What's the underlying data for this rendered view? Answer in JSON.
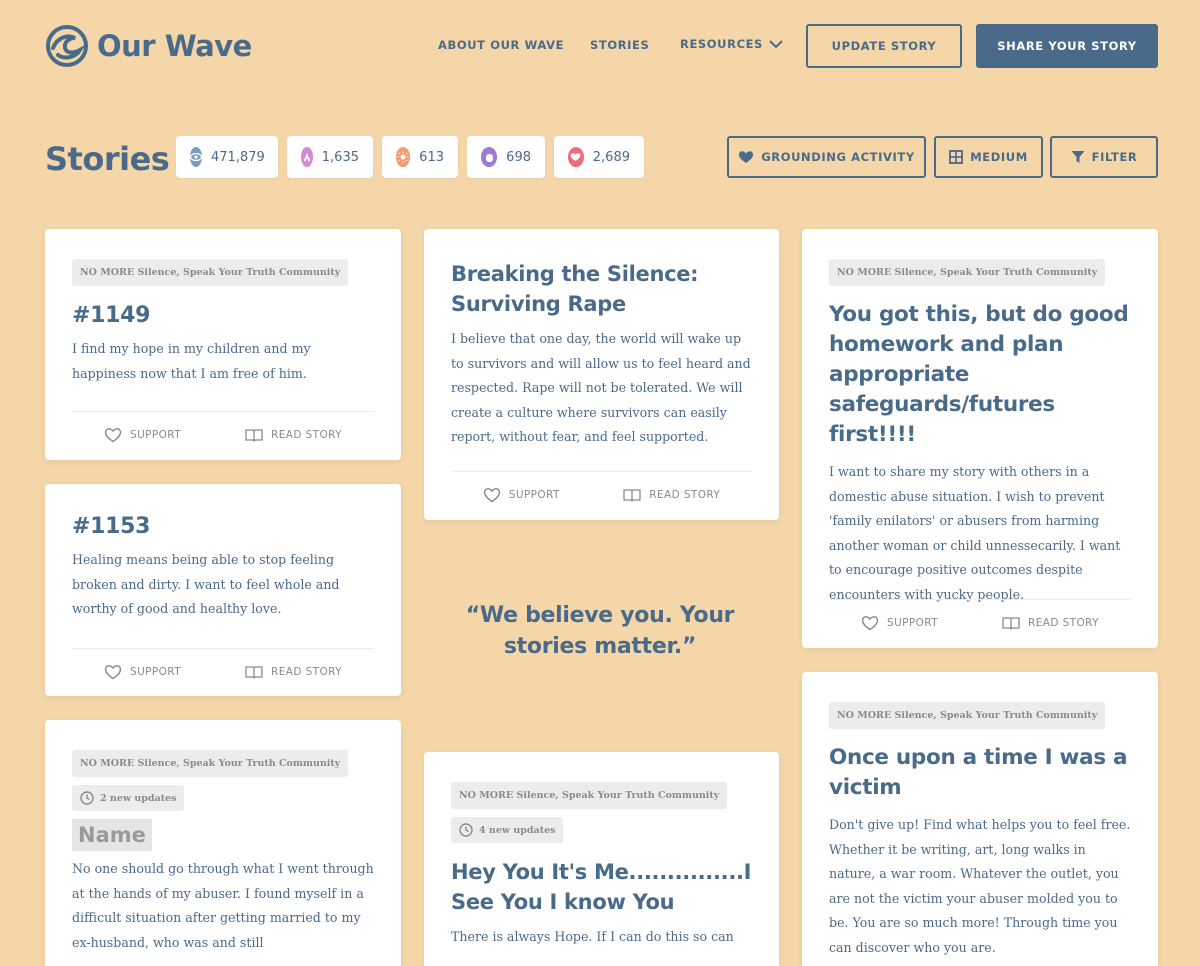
{
  "brand": {
    "name": "Our Wave"
  },
  "nav": {
    "about": "ABOUT OUR WAVE",
    "stories": "STORIES",
    "resources": "RESOURCES",
    "update_story": "UPDATE STORY",
    "share_story": "SHARE YOUR STORY"
  },
  "page": {
    "title": "Stories"
  },
  "stats": [
    {
      "icon": "eye-icon",
      "value": "471,879",
      "color": "#7b9bbf"
    },
    {
      "icon": "hands-icon",
      "value": "1,635",
      "color": "#d58ad8"
    },
    {
      "icon": "sun-icon",
      "value": "613",
      "color": "#f39a6d"
    },
    {
      "icon": "hand-icon",
      "value": "698",
      "color": "#9d7ad8"
    },
    {
      "icon": "heart-icon",
      "value": "2,689",
      "color": "#ee6b7a"
    }
  ],
  "controls": {
    "grounding": "GROUNDING ACTIVITY",
    "size": "MEDIUM",
    "filter": "FILTER"
  },
  "actions": {
    "support": "SUPPORT",
    "read": "READ STORY"
  },
  "quote": "“We believe you. Your stories matter.”",
  "cards": [
    {
      "tag": "NO MORE Silence, Speak Your Truth Community",
      "title": "#1149",
      "body": "I find my hope in my children and my happiness now that I am free of him."
    },
    {
      "title": "#1153",
      "body": "Healing means being able to stop feeling broken and dirty. I want to feel whole and worthy of good and healthy love."
    },
    {
      "tag": "NO MORE Silence, Speak Your Truth Community",
      "updates": "2 new updates",
      "title": "Name",
      "body": "No one should go through what I went through at the hands of my abuser. I found myself in a difficult situation after getting married to my ex-husband, who was and still"
    },
    {
      "title": "Breaking the Silence: Surviving Rape",
      "body": "I believe that one day, the world will wake up to survivors and will allow us to feel heard and respected. Rape will not be tolerated. We will create a culture where survivors can easily report, without fear, and feel supported."
    },
    {
      "tag": "NO MORE Silence, Speak Your Truth Community",
      "updates": "4 new updates",
      "title": "Hey You It's Me...............I See You I know You",
      "body": "There is always Hope. If I can do this so can"
    },
    {
      "tag": "NO MORE Silence, Speak Your Truth Community",
      "title": "You got this, but do good homework and plan appropriate safeguards/futures first!!!!",
      "body": "I want to share my story with others in a domestic abuse situation. I wish to prevent 'family enilators' or abusers from harming another woman or child unnessecarily. I want to encourage positive outcomes despite encounters with yucky people."
    },
    {
      "tag": "NO MORE Silence, Speak Your Truth Community",
      "title": "Once upon a time I was a victim",
      "body": "Don't give up! Find what helps you to feel free. Whether it be writing, art, long walks in nature, a war room. Whatever the outlet, you are not the victim your abuser molded you to be. You are so much more! Through time you can discover who you are."
    }
  ]
}
